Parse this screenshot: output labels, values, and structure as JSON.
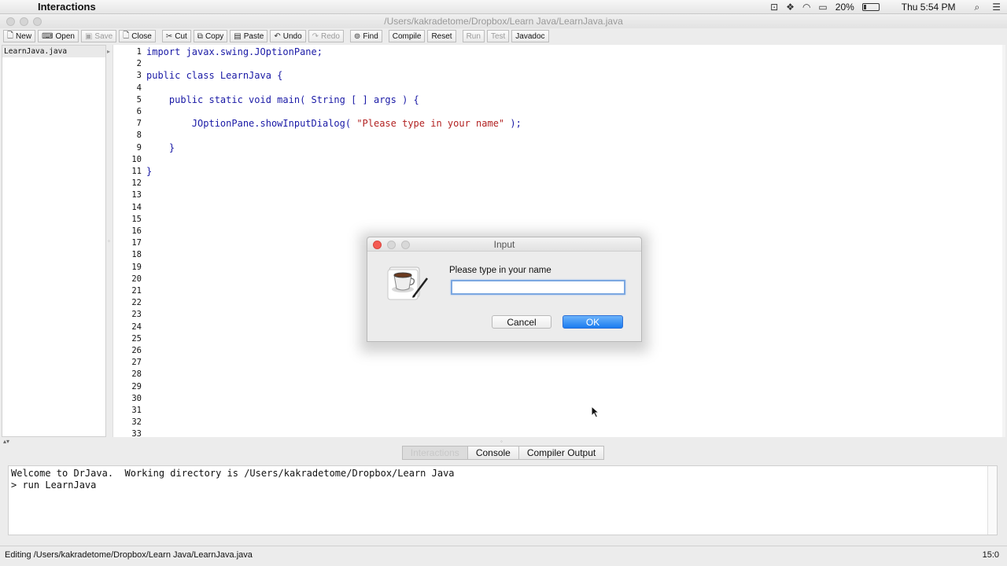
{
  "menubar": {
    "app_name": "Interactions",
    "battery_percent": "20%",
    "battery_level": 0.2,
    "clock": "Thu 5:54 PM"
  },
  "window": {
    "title": "/Users/kakradetome/Dropbox/Learn Java/LearnJava.java"
  },
  "toolbar": {
    "buttons": [
      {
        "label": "New",
        "icon": "new-file-icon",
        "glyph": "🗋",
        "enabled": true
      },
      {
        "label": "Open",
        "icon": "open-folder-icon",
        "glyph": "⌨",
        "enabled": true
      },
      {
        "label": "Save",
        "icon": "save-icon",
        "glyph": "▣",
        "enabled": false
      },
      {
        "label": "Close",
        "icon": "close-file-icon",
        "glyph": "🗋",
        "enabled": true
      },
      {
        "label": "Cut",
        "icon": "scissors-icon",
        "glyph": "✂",
        "enabled": true
      },
      {
        "label": "Copy",
        "icon": "copy-icon",
        "glyph": "⧉",
        "enabled": true
      },
      {
        "label": "Paste",
        "icon": "paste-icon",
        "glyph": "▤",
        "enabled": true
      },
      {
        "label": "Undo",
        "icon": "undo-icon",
        "glyph": "↶",
        "enabled": true
      },
      {
        "label": "Redo",
        "icon": "redo-icon",
        "glyph": "↷",
        "enabled": false
      },
      {
        "label": "Find",
        "icon": "binoculars-icon",
        "glyph": "⊚",
        "enabled": true
      },
      {
        "label": "Compile",
        "icon": "",
        "glyph": "",
        "enabled": true
      },
      {
        "label": "Reset",
        "icon": "",
        "glyph": "",
        "enabled": true
      },
      {
        "label": "Run",
        "icon": "",
        "glyph": "",
        "enabled": false
      },
      {
        "label": "Test",
        "icon": "",
        "glyph": "",
        "enabled": false
      },
      {
        "label": "Javadoc",
        "icon": "",
        "glyph": "",
        "enabled": true
      }
    ]
  },
  "file_pane": {
    "files": [
      "LearnJava.java"
    ]
  },
  "editor": {
    "line_count": 33,
    "lines": [
      [
        {
          "t": "import javax.swing.JOptionPane;",
          "c": "kw"
        }
      ],
      [],
      [
        {
          "t": "public class LearnJava {",
          "c": "kw"
        }
      ],
      [],
      [
        {
          "t": "    public static void main( String [ ] args ) {",
          "c": "kw"
        }
      ],
      [],
      [
        {
          "t": "        JOptionPane.showInputDialog( ",
          "c": "kw"
        },
        {
          "t": "\"Please type in your name\"",
          "c": "str"
        },
        {
          "t": " );",
          "c": "kw"
        }
      ],
      [],
      [
        {
          "t": "    }",
          "c": "kw"
        }
      ],
      [],
      [
        {
          "t": "}",
          "c": "kw"
        }
      ]
    ]
  },
  "bottom_tabs": {
    "interactions": "Interactions",
    "console": "Console",
    "compiler_output": "Compiler Output"
  },
  "interactions_pane": {
    "lines": [
      "Welcome to DrJava.  Working directory is /Users/kakradetome/Dropbox/Learn Java",
      "> run LearnJava"
    ]
  },
  "statusbar": {
    "text": "Editing /Users/kakradetome/Dropbox/Learn Java/LearnJava.java",
    "position": "15:0"
  },
  "dialog": {
    "title": "Input",
    "message": "Please type in your name",
    "input_value": "",
    "cancel_label": "Cancel",
    "ok_label": "OK",
    "colors": {
      "ok": "#1b7cf0",
      "close_light": "#f45a52"
    }
  }
}
